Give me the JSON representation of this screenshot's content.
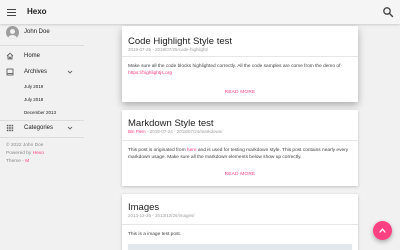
{
  "appbar": {
    "title": "Hexo",
    "menu_icon": "menu-icon",
    "search_icon": "search-icon"
  },
  "sidebar": {
    "profile": {
      "name": "John Doe",
      "avatar_icon": "account-circle-icon"
    },
    "nav": {
      "home": {
        "label": "Home",
        "icon": "home-icon"
      },
      "archives": {
        "label": "Archives",
        "icon": "archive-icon",
        "expanded": true
      },
      "categories": {
        "label": "Categories",
        "icon": "apps-icon",
        "expanded": false
      }
    },
    "archive_items": [
      "July 2019",
      "July 2018",
      "December 2013"
    ],
    "footer": {
      "copyright": "© 2022 John Doe",
      "powered_prefix": "Powered by ",
      "powered_link": "Hexo",
      "theme_prefix": "Theme - ",
      "theme_link": "M"
    }
  },
  "posts": [
    {
      "title": "Code Highlight Style test",
      "meta": "2019-07-25 - 2019/07/25/code-highlight/",
      "excerpt_before": "Make sure all the code blocks highlighted correctly. All the code samples are come from the demo of ",
      "excerpt_link": "https://highlightjs.org",
      "read_more": "READ MORE"
    },
    {
      "title": "Markdown Style test",
      "meta_author": "Bin Flem",
      "meta_rest": " - 2018-07-24 - 2018/07/24/markdown/",
      "excerpt_before": "This post is originated from ",
      "excerpt_link": "here",
      "excerpt_after": " and is used for testing markdown style. This post contains nearly every markdown usage. Make sure all the markdown elements below show up correctly.",
      "read_more": "READ MORE"
    },
    {
      "title": "Images",
      "meta": "2013-12-26 - 2013/12/26/images/",
      "text": "This is a image test post."
    }
  ],
  "colors": {
    "accent": "#ff4081",
    "background": "#f1f1f1",
    "card": "#ffffff"
  },
  "fab": {
    "icon": "keyboard-arrow-up-icon"
  }
}
